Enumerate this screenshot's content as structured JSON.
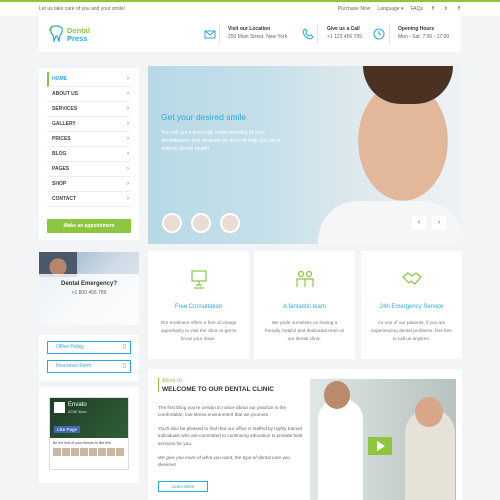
{
  "topbar": {
    "tagline": "Let us take care of you and your smile!",
    "purchase": "Purchase Now",
    "language": "Language",
    "faqs": "FAQs",
    "social": [
      "f",
      "t",
      "f"
    ]
  },
  "header": {
    "logo_line1": "Dental",
    "logo_line2": "Press",
    "location_title": "Visit our Location",
    "location_text": "250 Main Street, New York",
    "call_title": "Give us a Call",
    "call_text": "+1 123 456 789",
    "hours_title": "Opening Hours",
    "hours_text": "Mon - Sat: 7:00 - 17:00"
  },
  "sidebar": {
    "items": [
      {
        "label": "HOME"
      },
      {
        "label": "ABOUT US"
      },
      {
        "label": "SERVICES"
      },
      {
        "label": "GALLERY"
      },
      {
        "label": "PRICES"
      },
      {
        "label": "BLOG"
      },
      {
        "label": "PAGES"
      },
      {
        "label": "SHOP"
      },
      {
        "label": "CONTACT"
      }
    ],
    "appointment": "Make an appointment",
    "emergency_title": "Dental Emergency?",
    "emergency_phone": "+1 800 456 789",
    "office_policy": "Office Policy",
    "insurance_form": "Insurance Form",
    "fb_name": "Envato",
    "fb_likes": "203K likes",
    "fb_like_btn": "Like Page",
    "fb_friends": "Be the first of your friends to like this"
  },
  "hero": {
    "title": "Get your desired smile",
    "text": "You will get a thorough understanding of your dentalissues and whatcan be done to help you be in optimal dental health.",
    "prev": "‹",
    "next": "›"
  },
  "features": [
    {
      "title": "Free Consultation",
      "text": "Our treatment offers a free of charge opportunity to visit the clinic to get to know your issue."
    },
    {
      "title": "A fantastic team",
      "text": "We pride ourselves on having a friendly, helpful and dedicated team at our dental clinic."
    },
    {
      "title": "24h Emergency Service",
      "text": "As one of our patients, if you are experiencing dental problems, feel free to call us anytime."
    }
  ],
  "about": {
    "label": "About Us",
    "title": "WELCOME TO OUR DENTAL CLINIC",
    "p1": "The first thing you're certain to notice about our practice is the comfortable, low-stress environment that we promote.",
    "p2": "You'll also be pleased to find that our office is staffed by highly trained individuals who are committed to continuing education to provide best services for you.",
    "p3": "We give you more of what you want, the type of dental care you deserve!",
    "more": "Learn More"
  },
  "colors": {
    "green": "#8cc63f",
    "blue": "#29a8df"
  }
}
